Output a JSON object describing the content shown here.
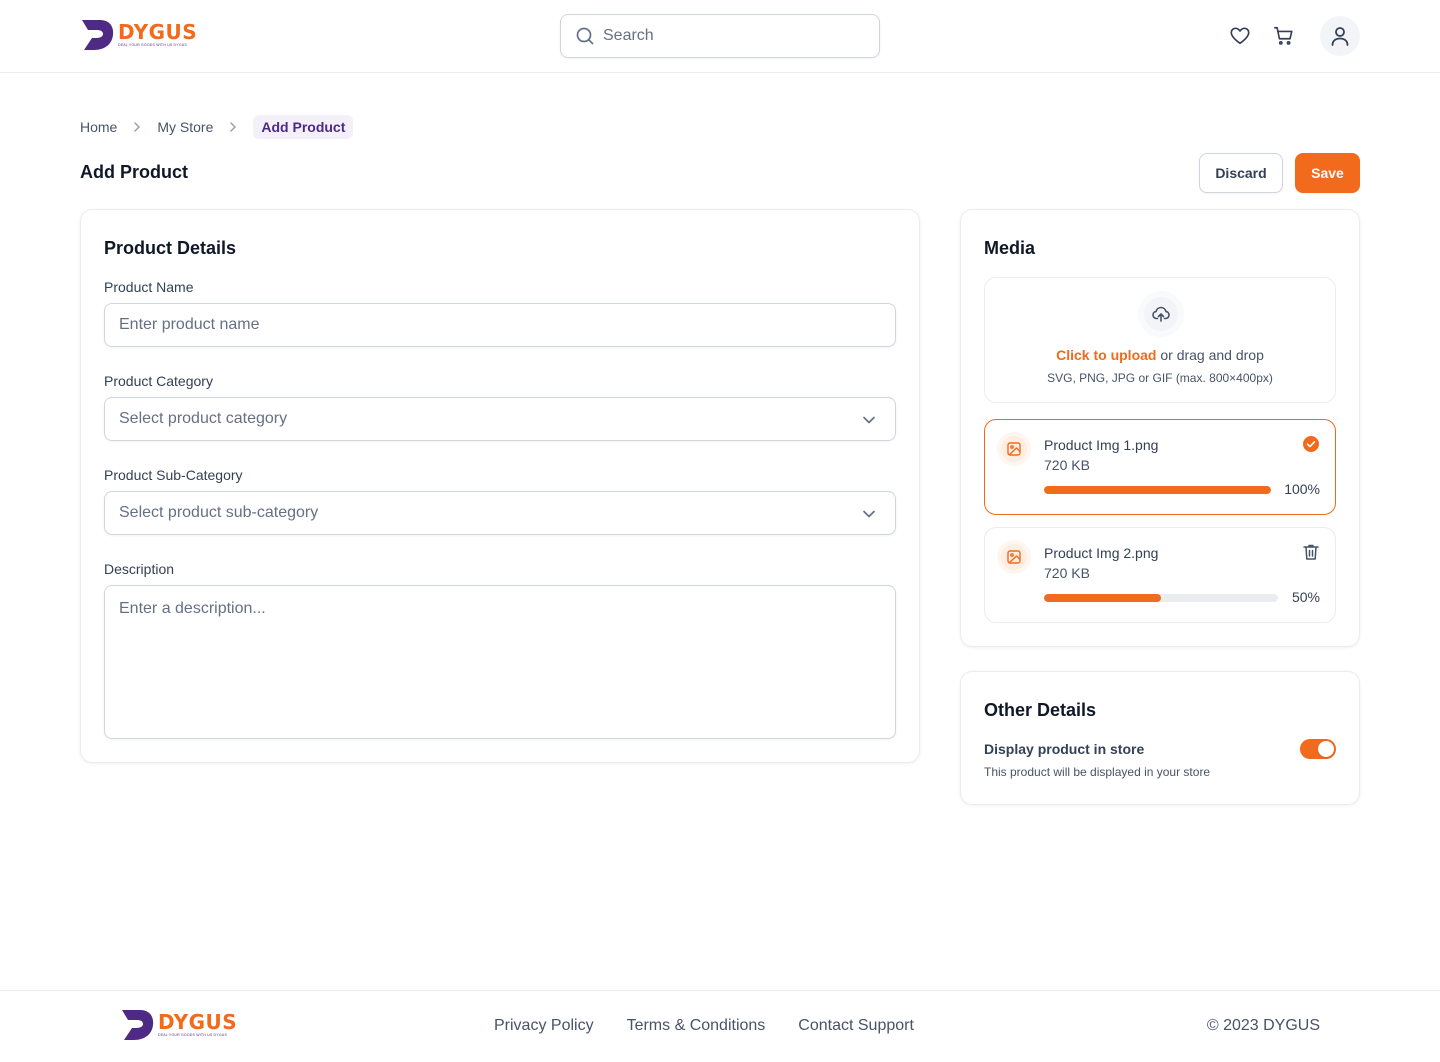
{
  "brand": {
    "name": "DYGUS",
    "tagline": "DEAL YOUR GOODS WITH US DYGUS",
    "accent": "#f26a1b",
    "secondary": "#4e2a84"
  },
  "header": {
    "search": {
      "placeholder": "Search",
      "value": ""
    },
    "icons": [
      "heart-icon",
      "cart-icon",
      "user-icon"
    ]
  },
  "breadcrumb": [
    "Home",
    "My Store",
    "Add Product"
  ],
  "page": {
    "title": "Add Product",
    "discard_label": "Discard",
    "save_label": "Save"
  },
  "product_details": {
    "title": "Product Details",
    "name": {
      "label": "Product Name",
      "placeholder": "Enter product name"
    },
    "category": {
      "label": "Product Category",
      "placeholder": "Select product category"
    },
    "sub_category": {
      "label": "Product Sub-Category",
      "placeholder": "Select product sub-category"
    },
    "description": {
      "label": "Description",
      "placeholder": "Enter a description..."
    }
  },
  "media": {
    "title": "Media",
    "upload_link": "Click to upload",
    "upload_text": " or drag and drop",
    "upload_hint": "SVG, PNG, JPG or GIF (max. 800×400px)",
    "files": [
      {
        "name": "Product Img 1.png",
        "size": "720 KB",
        "progress": 100,
        "progress_label": "100%",
        "status": "complete"
      },
      {
        "name": "Product Img 2.png",
        "size": "720 KB",
        "progress": 50,
        "progress_label": "50%",
        "status": "uploading"
      }
    ]
  },
  "other_details": {
    "title": "Other Details",
    "toggle_label": "Display product in store",
    "toggle_hint": "This product will be displayed in your store",
    "toggle_on": true
  },
  "footer": {
    "links": [
      "Privacy Policy",
      "Terms & Conditions",
      "Contact Support"
    ],
    "copyright": "© 2023 DYGUS"
  }
}
